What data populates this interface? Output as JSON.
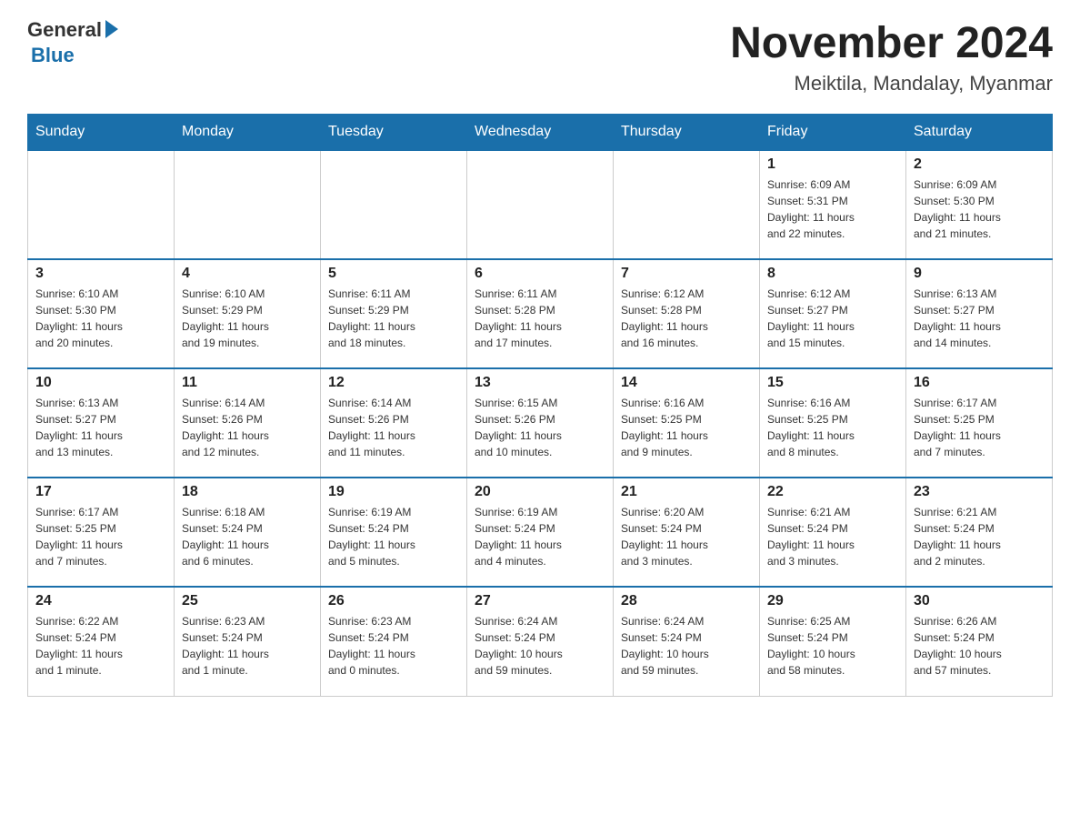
{
  "header": {
    "logo_general": "General",
    "logo_blue": "Blue",
    "month_title": "November 2024",
    "location": "Meiktila, Mandalay, Myanmar"
  },
  "weekdays": [
    "Sunday",
    "Monday",
    "Tuesday",
    "Wednesday",
    "Thursday",
    "Friday",
    "Saturday"
  ],
  "weeks": [
    [
      {
        "day": "",
        "info": ""
      },
      {
        "day": "",
        "info": ""
      },
      {
        "day": "",
        "info": ""
      },
      {
        "day": "",
        "info": ""
      },
      {
        "day": "",
        "info": ""
      },
      {
        "day": "1",
        "info": "Sunrise: 6:09 AM\nSunset: 5:31 PM\nDaylight: 11 hours\nand 22 minutes."
      },
      {
        "day": "2",
        "info": "Sunrise: 6:09 AM\nSunset: 5:30 PM\nDaylight: 11 hours\nand 21 minutes."
      }
    ],
    [
      {
        "day": "3",
        "info": "Sunrise: 6:10 AM\nSunset: 5:30 PM\nDaylight: 11 hours\nand 20 minutes."
      },
      {
        "day": "4",
        "info": "Sunrise: 6:10 AM\nSunset: 5:29 PM\nDaylight: 11 hours\nand 19 minutes."
      },
      {
        "day": "5",
        "info": "Sunrise: 6:11 AM\nSunset: 5:29 PM\nDaylight: 11 hours\nand 18 minutes."
      },
      {
        "day": "6",
        "info": "Sunrise: 6:11 AM\nSunset: 5:28 PM\nDaylight: 11 hours\nand 17 minutes."
      },
      {
        "day": "7",
        "info": "Sunrise: 6:12 AM\nSunset: 5:28 PM\nDaylight: 11 hours\nand 16 minutes."
      },
      {
        "day": "8",
        "info": "Sunrise: 6:12 AM\nSunset: 5:27 PM\nDaylight: 11 hours\nand 15 minutes."
      },
      {
        "day": "9",
        "info": "Sunrise: 6:13 AM\nSunset: 5:27 PM\nDaylight: 11 hours\nand 14 minutes."
      }
    ],
    [
      {
        "day": "10",
        "info": "Sunrise: 6:13 AM\nSunset: 5:27 PM\nDaylight: 11 hours\nand 13 minutes."
      },
      {
        "day": "11",
        "info": "Sunrise: 6:14 AM\nSunset: 5:26 PM\nDaylight: 11 hours\nand 12 minutes."
      },
      {
        "day": "12",
        "info": "Sunrise: 6:14 AM\nSunset: 5:26 PM\nDaylight: 11 hours\nand 11 minutes."
      },
      {
        "day": "13",
        "info": "Sunrise: 6:15 AM\nSunset: 5:26 PM\nDaylight: 11 hours\nand 10 minutes."
      },
      {
        "day": "14",
        "info": "Sunrise: 6:16 AM\nSunset: 5:25 PM\nDaylight: 11 hours\nand 9 minutes."
      },
      {
        "day": "15",
        "info": "Sunrise: 6:16 AM\nSunset: 5:25 PM\nDaylight: 11 hours\nand 8 minutes."
      },
      {
        "day": "16",
        "info": "Sunrise: 6:17 AM\nSunset: 5:25 PM\nDaylight: 11 hours\nand 7 minutes."
      }
    ],
    [
      {
        "day": "17",
        "info": "Sunrise: 6:17 AM\nSunset: 5:25 PM\nDaylight: 11 hours\nand 7 minutes."
      },
      {
        "day": "18",
        "info": "Sunrise: 6:18 AM\nSunset: 5:24 PM\nDaylight: 11 hours\nand 6 minutes."
      },
      {
        "day": "19",
        "info": "Sunrise: 6:19 AM\nSunset: 5:24 PM\nDaylight: 11 hours\nand 5 minutes."
      },
      {
        "day": "20",
        "info": "Sunrise: 6:19 AM\nSunset: 5:24 PM\nDaylight: 11 hours\nand 4 minutes."
      },
      {
        "day": "21",
        "info": "Sunrise: 6:20 AM\nSunset: 5:24 PM\nDaylight: 11 hours\nand 3 minutes."
      },
      {
        "day": "22",
        "info": "Sunrise: 6:21 AM\nSunset: 5:24 PM\nDaylight: 11 hours\nand 3 minutes."
      },
      {
        "day": "23",
        "info": "Sunrise: 6:21 AM\nSunset: 5:24 PM\nDaylight: 11 hours\nand 2 minutes."
      }
    ],
    [
      {
        "day": "24",
        "info": "Sunrise: 6:22 AM\nSunset: 5:24 PM\nDaylight: 11 hours\nand 1 minute."
      },
      {
        "day": "25",
        "info": "Sunrise: 6:23 AM\nSunset: 5:24 PM\nDaylight: 11 hours\nand 1 minute."
      },
      {
        "day": "26",
        "info": "Sunrise: 6:23 AM\nSunset: 5:24 PM\nDaylight: 11 hours\nand 0 minutes."
      },
      {
        "day": "27",
        "info": "Sunrise: 6:24 AM\nSunset: 5:24 PM\nDaylight: 10 hours\nand 59 minutes."
      },
      {
        "day": "28",
        "info": "Sunrise: 6:24 AM\nSunset: 5:24 PM\nDaylight: 10 hours\nand 59 minutes."
      },
      {
        "day": "29",
        "info": "Sunrise: 6:25 AM\nSunset: 5:24 PM\nDaylight: 10 hours\nand 58 minutes."
      },
      {
        "day": "30",
        "info": "Sunrise: 6:26 AM\nSunset: 5:24 PM\nDaylight: 10 hours\nand 57 minutes."
      }
    ]
  ]
}
